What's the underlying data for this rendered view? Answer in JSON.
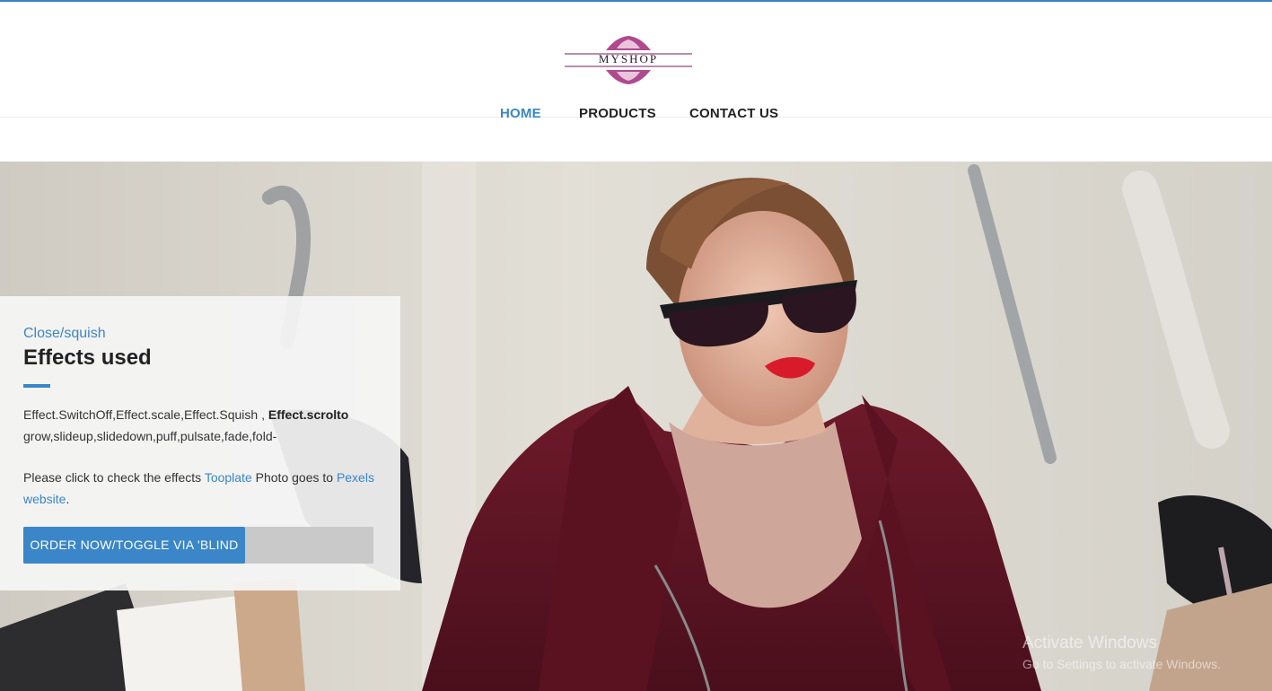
{
  "brand": {
    "logo_text": "MYSHOP"
  },
  "nav": {
    "items": [
      {
        "label": "HOME",
        "active": true
      },
      {
        "label": "PRODUCTS",
        "active": false
      },
      {
        "label": "CONTACT US",
        "active": false
      }
    ]
  },
  "hero": {
    "eyebrow": "Close/squish",
    "title": "Effects used",
    "effects_text": "Effect.SwitchOff,Effect.scale,Effect.Squish , ",
    "effects_bold": "Effect.scrolto",
    "effects_text2": " grow,slideup,slidedown,puff,pulsate,fade,fold-",
    "description_prefix": "Please click to check the effects ",
    "link_tooplate": "Tooplate",
    "description_middle": " Photo goes to ",
    "link_pexels": "Pexels website",
    "description_suffix": ".",
    "button_label": "ORDER NOW/TOGGLE VIA 'BLIND"
  },
  "watermark": {
    "line1": "Activate Windows",
    "line2": "Go to Settings to activate Windows."
  },
  "colors": {
    "accent": "#3a86c8",
    "text": "#222222"
  }
}
